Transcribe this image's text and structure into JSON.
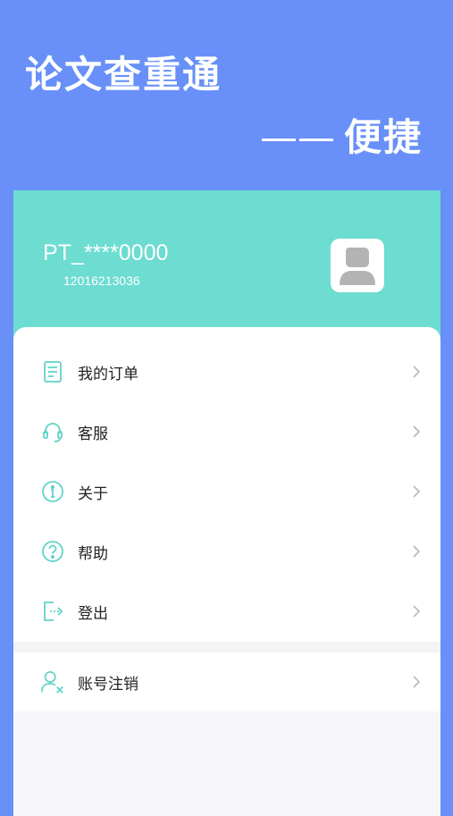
{
  "hero": {
    "title": "论文查重通",
    "subtitle_dash": "——",
    "subtitle": "便捷"
  },
  "profile": {
    "username": "PT_****0000",
    "user_id": "12016213036",
    "avatar_icon": "user-avatar-icon"
  },
  "menu": {
    "items": [
      {
        "label": "我的订单",
        "icon": "order-list-icon"
      },
      {
        "label": "客服",
        "icon": "headset-icon"
      },
      {
        "label": "关于",
        "icon": "info-icon"
      },
      {
        "label": "帮助",
        "icon": "help-icon"
      },
      {
        "label": "登出",
        "icon": "logout-icon"
      }
    ],
    "secondary": [
      {
        "label": "账号注销",
        "icon": "delete-account-icon"
      }
    ]
  },
  "colors": {
    "background": "#6890f8",
    "profile_bg": "#6ddcd1",
    "icon_accent": "#5fd3c6",
    "text": "#222222",
    "chevron": "#b8b8b8"
  }
}
